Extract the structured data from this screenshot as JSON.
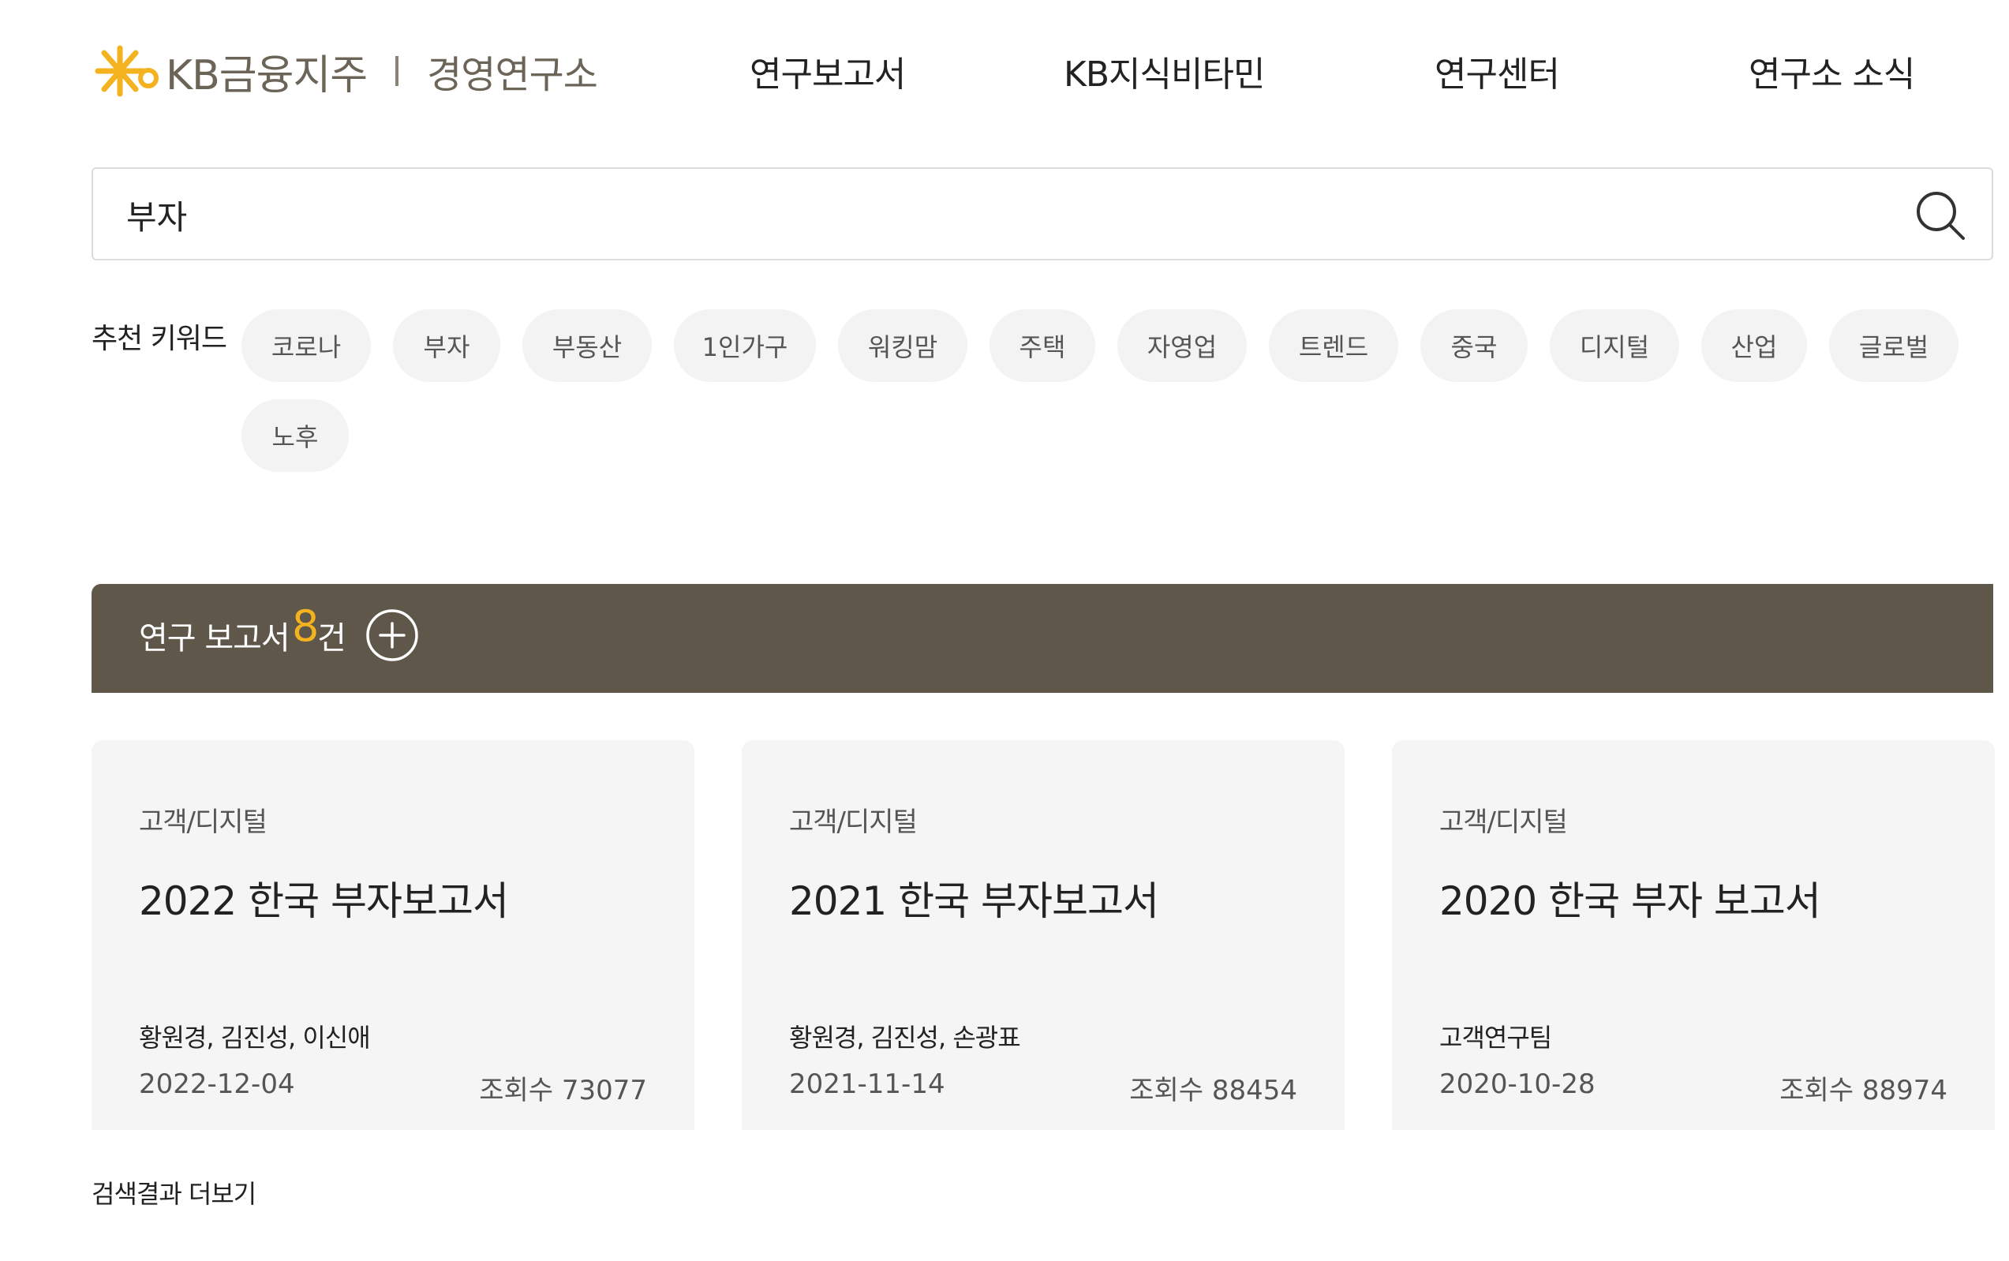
{
  "header": {
    "brand": "KB금융지주",
    "sub_brand": "경영연구소",
    "nav": [
      "연구보고서",
      "KB지식비타민",
      "연구센터",
      "연구소 소식"
    ]
  },
  "search": {
    "value": "부자"
  },
  "keywords": {
    "label": "추천 키워드",
    "items": [
      "코로나",
      "부자",
      "부동산",
      "1인가구",
      "워킹맘",
      "주택",
      "자영업",
      "트렌드",
      "중국",
      "디지털",
      "산업",
      "글로벌",
      "노후"
    ]
  },
  "results": {
    "title": "연구 보고서",
    "count": "8",
    "unit": "건",
    "cards": [
      {
        "category": "고객/디지털",
        "title": "2022 한국 부자보고서",
        "authors": "황원경, 김진성, 이신애",
        "date": "2022-12-04",
        "views": "조회수 73077"
      },
      {
        "category": "고객/디지털",
        "title": "2021 한국 부자보고서",
        "authors": "황원경, 김진성, 손광표",
        "date": "2021-11-14",
        "views": "조회수 88454"
      },
      {
        "category": "고객/디지털",
        "title": "2020 한국 부자 보고서",
        "authors": "고객연구팀",
        "date": "2020-10-28",
        "views": "조회수 88974"
      }
    ]
  },
  "more_label": "검색결과 더보기",
  "colors": {
    "brand_gold": "#f5b21f",
    "bar_brown": "#5e574a",
    "chip_bg": "#f3f3f3",
    "card_bg": "#f5f5f5"
  }
}
